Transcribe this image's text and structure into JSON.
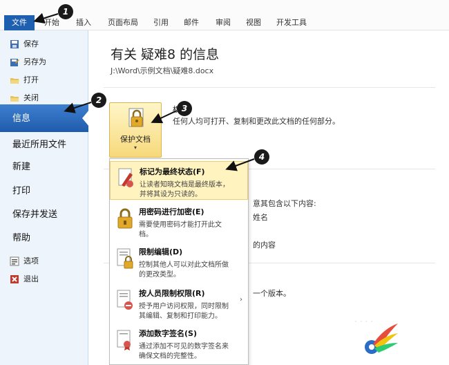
{
  "ribbon": {
    "tabs": [
      "文件",
      "开始",
      "插入",
      "页面布局",
      "引用",
      "邮件",
      "审阅",
      "视图",
      "开发工具"
    ]
  },
  "sidebar": {
    "small_items_top": [
      {
        "label": "保存",
        "icon": "save-icon"
      },
      {
        "label": "另存为",
        "icon": "save-as-icon"
      },
      {
        "label": "打开",
        "icon": "open-folder-icon"
      },
      {
        "label": "关闭",
        "icon": "close-folder-icon"
      }
    ],
    "selected": "信息",
    "big_items": [
      "最近所用文件",
      "新建",
      "打印",
      "保存并发送",
      "帮助"
    ],
    "small_items_bottom": [
      {
        "label": "选项",
        "icon": "options-icon"
      },
      {
        "label": "退出",
        "icon": "exit-icon"
      }
    ]
  },
  "main": {
    "title": "有关 疑难8 的信息",
    "path": "J:\\Word\\示例文档\\疑难8.docx",
    "permissions_heading": "权",
    "permissions_desc": "任何人均可打开、复制和更改此文档的任何部分。",
    "protect_button_label": "保护文档",
    "bg_texts": [
      "意其包含以下内容:",
      "姓名",
      "的内容",
      "一个版本。"
    ]
  },
  "menu": {
    "items": [
      {
        "title": "标记为最终状态(F)",
        "desc1": "让读者知晓文档是最终版本，",
        "desc2": "并将其设为只读的。",
        "icon": "mark-final-icon",
        "highlighted": true
      },
      {
        "title": "用密码进行加密(E)",
        "desc1": "需要使用密码才能打开此文",
        "desc2": "档。",
        "icon": "encrypt-lock-icon",
        "highlighted": false
      },
      {
        "title": "限制编辑(D)",
        "desc1": "控制其他人可以对此文档所做",
        "desc2": "的更改类型。",
        "icon": "restrict-editing-icon",
        "highlighted": false
      },
      {
        "title": "按人员限制权限(R)",
        "desc1": "授予用户访问权限，同时限制",
        "desc2": "其编辑、复制和打印能力。",
        "icon": "restrict-permission-icon",
        "highlighted": false,
        "submenu": true
      },
      {
        "title": "添加数字签名(S)",
        "desc1": "通过添加不可见的数字签名来",
        "desc2": "确保文档的完整性。",
        "icon": "digital-signature-icon",
        "highlighted": false
      }
    ]
  },
  "callouts": [
    "1",
    "2",
    "3",
    "4"
  ],
  "watermark": "· · · ·"
}
